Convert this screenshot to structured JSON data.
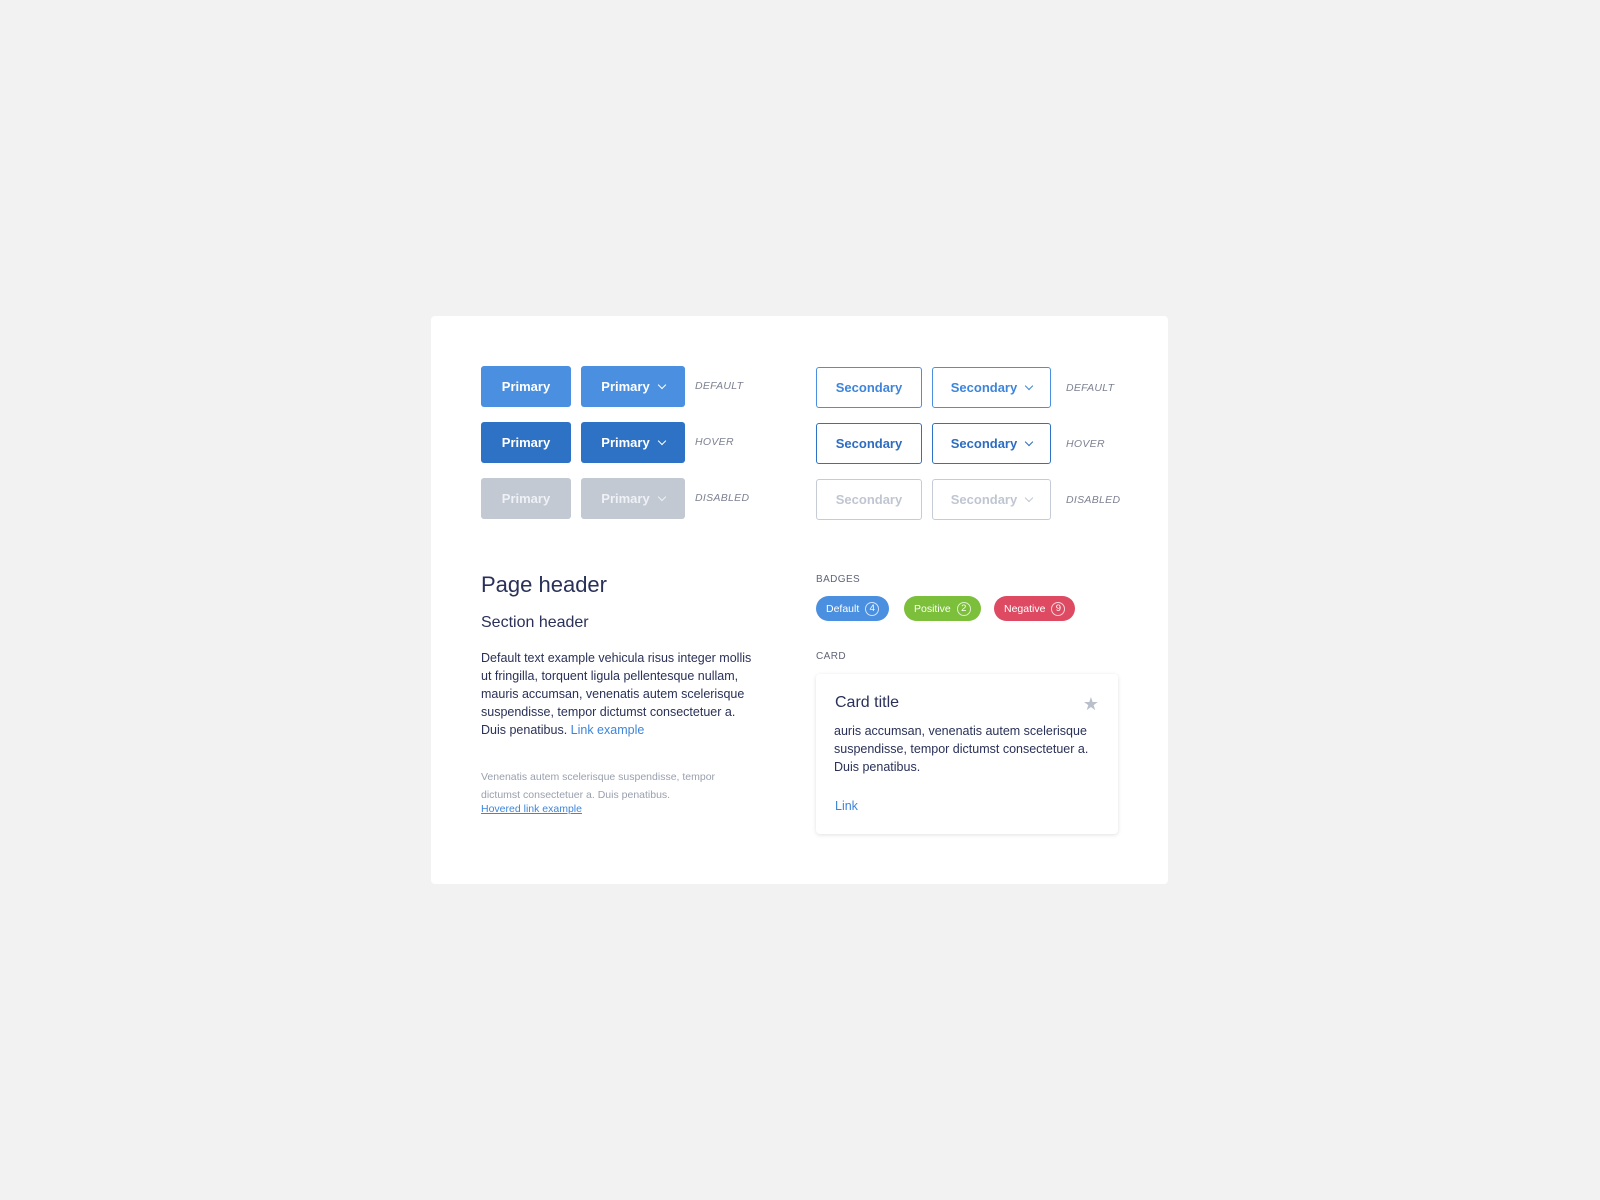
{
  "buttons": {
    "primary": [
      {
        "state": "DEFAULT",
        "label": "Primary",
        "dropdown_label": "Primary"
      },
      {
        "state": "HOVER",
        "label": "Primary",
        "dropdown_label": "Primary"
      },
      {
        "state": "DISABLED",
        "label": "Primary",
        "dropdown_label": "Primary"
      }
    ],
    "secondary": [
      {
        "state": "DEFAULT",
        "label": "Secondary",
        "dropdown_label": "Secondary"
      },
      {
        "state": "HOVER",
        "label": "Secondary",
        "dropdown_label": "Secondary"
      },
      {
        "state": "DISABLED",
        "label": "Secondary",
        "dropdown_label": "Secondary"
      }
    ]
  },
  "typography": {
    "page_header": "Page header",
    "section_header": "Section header",
    "body_text": "Default text example vehicula risus integer mollis ut fringilla, torquent ligula pellentesque nullam, mauris accumsan, venenatis autem scelerisque suspendisse, tempor dictumst consectetuer a. Duis penatibus.",
    "link_text": "Link example",
    "small_text": "Venenatis autem scelerisque suspendisse, tempor dictumst consectetuer a. Duis penatibus.",
    "hovered_link_text": "Hovered link example"
  },
  "badges": {
    "label": "BADGES",
    "items": [
      {
        "label": "Default",
        "count": "4",
        "color": "#4a8fe0"
      },
      {
        "label": "Positive",
        "count": "2",
        "color": "#7cbf3a"
      },
      {
        "label": "Negative",
        "count": "9",
        "color": "#de4a62"
      }
    ]
  },
  "card": {
    "label": "CARD",
    "title": "Card title",
    "icon": "star-icon",
    "body": "auris accumsan, venenatis autem scelerisque suspendisse, tempor dictumst consectetuer a. Duis penatibus.",
    "link": "Link"
  }
}
